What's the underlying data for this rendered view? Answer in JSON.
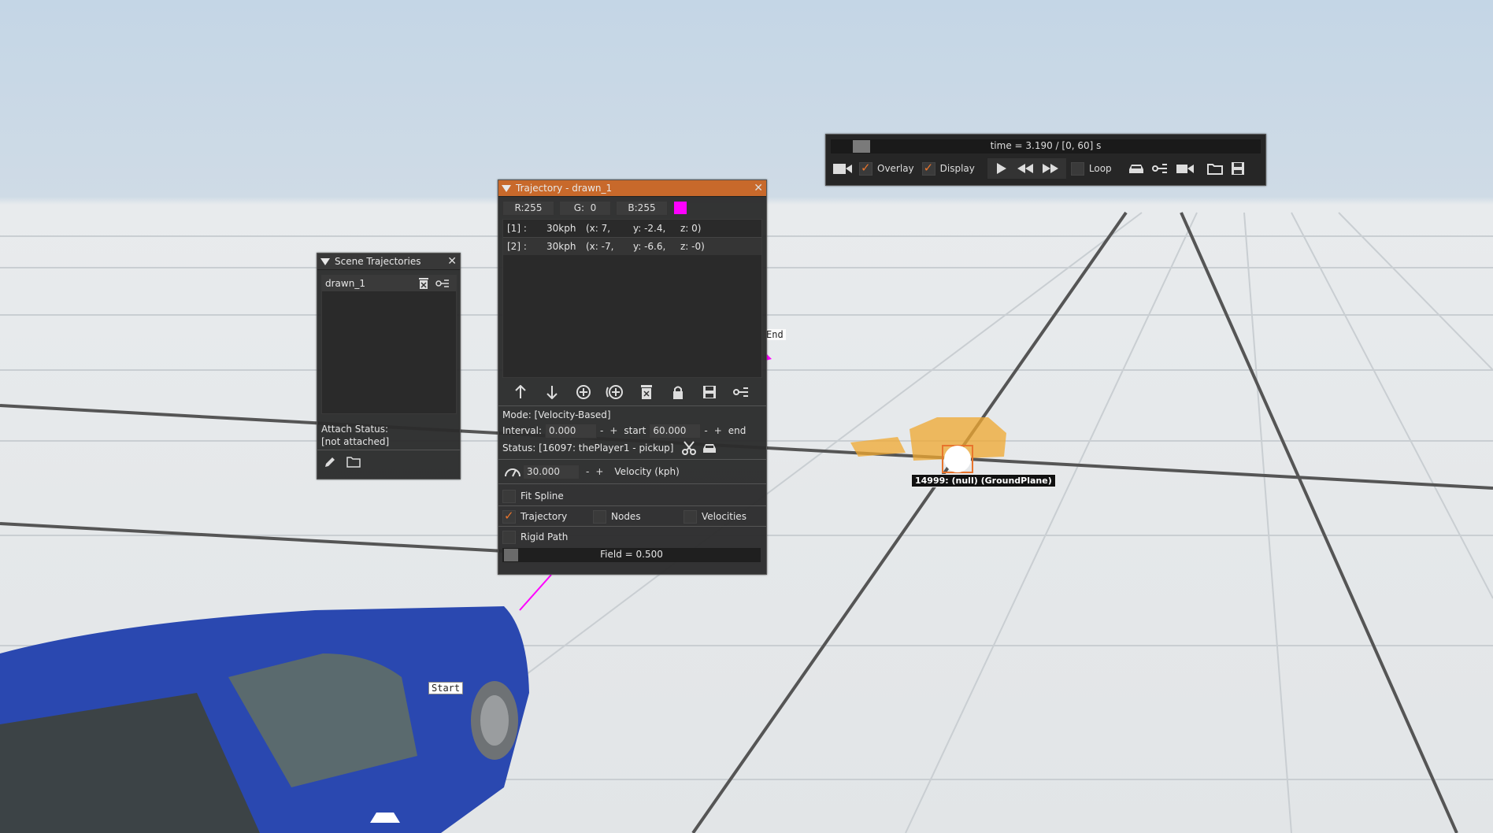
{
  "timeline": {
    "time_text": "time = 3.190 / [0, 60] s",
    "overlay_label": "Overlay",
    "display_label": "Display",
    "loop_label": "Loop",
    "overlay_checked": true,
    "display_checked": true,
    "loop_checked": false,
    "progress_fraction": 0.053
  },
  "scene_trajectories": {
    "title": "Scene Trajectories",
    "items": [
      {
        "name": "drawn_1"
      }
    ],
    "attach_status_label": "Attach Status:",
    "attach_status_value": "[not attached]"
  },
  "trajectory": {
    "title": "Trajectory - drawn_1",
    "color": {
      "r_label": "R:255",
      "g_label": "G:  0",
      "b_label": "B:255",
      "swatch": "#ff00ff"
    },
    "nodes": [
      {
        "index": "[1] :",
        "speed": "30kph",
        "x": "(x: 7,",
        "y": "y: -2.4,",
        "z": "z: 0)"
      },
      {
        "index": "[2] :",
        "speed": "30kph",
        "x": "(x: -7,",
        "y": "y: -6.6,",
        "z": "z: -0)"
      }
    ],
    "mode_text": "Mode: [Velocity-Based]",
    "interval_label": "Interval:",
    "interval_value": "0.000",
    "start_label": "start",
    "start_value": "60.000",
    "end_label": "end",
    "status_text": "Status: [16097: thePlayer1 - pickup]",
    "velocity_value": "30.000",
    "velocity_label": "Velocity (kph)",
    "fit_spline_label": "Fit Spline",
    "trajectory_label": "Trajectory",
    "nodes_label": "Nodes",
    "velocities_label": "Velocities",
    "rigid_path_label": "Rigid Path",
    "fit_spline_checked": false,
    "trajectory_checked": true,
    "nodes_checked": false,
    "velocities_checked": false,
    "rigid_path_checked": false,
    "field_text": "Field = 0.500",
    "minus": "-",
    "plus": "+"
  },
  "scene": {
    "start_label": "Start",
    "end_label": "End",
    "object_tooltip": "14999: (null) (GroundPlane)",
    "accent_color": "#c8692b"
  }
}
